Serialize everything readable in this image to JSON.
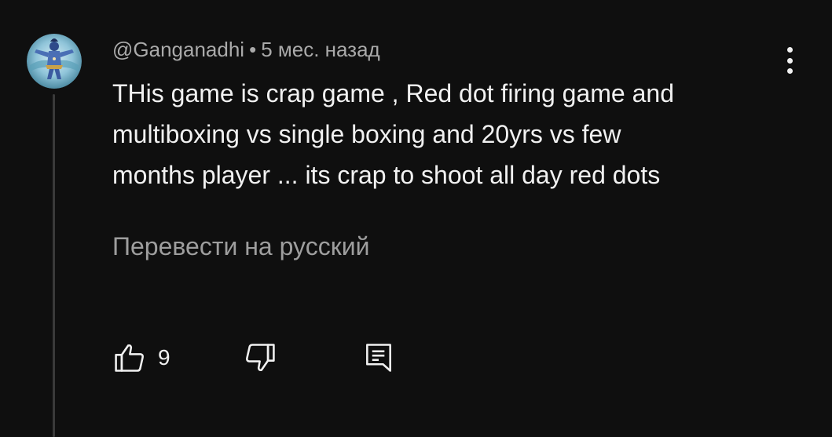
{
  "comment": {
    "author": "@Ganganadhi",
    "separator": "•",
    "timestamp": "5 мес. назад",
    "text": "THis game is crap game , Red dot firing game and\nmultiboxing vs single boxing and 20yrs vs few\nmonths player ... its crap to shoot all day red dots",
    "translate_label": "Перевести на русский",
    "like_count": "9"
  },
  "icons": {
    "avatar": "avatar",
    "menu": "more-vert-icon",
    "like": "thumb-up-icon",
    "dislike": "thumb-down-icon",
    "reply": "reply-comment-icon"
  },
  "colors": {
    "background": "#0f0f0f",
    "primary_text": "#f1f1f1",
    "secondary_text": "#aaaaaa"
  }
}
